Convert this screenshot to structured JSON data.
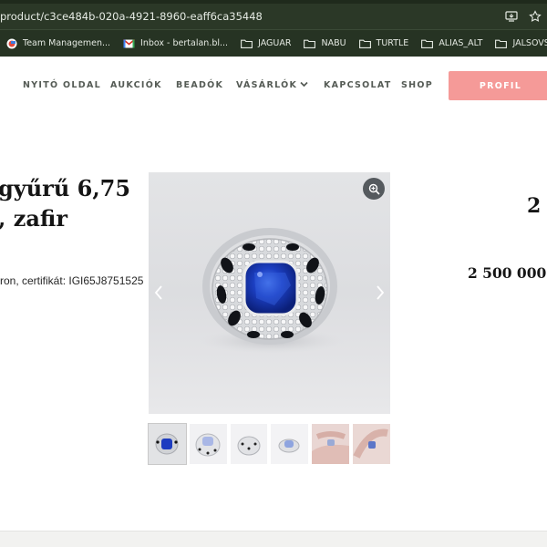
{
  "browser": {
    "url": "product/c3ce484b-020a-4921-8960-eaff6ca35448",
    "bookmarks": [
      {
        "label": "Team Managemen...",
        "icon": "app-icon"
      },
      {
        "label": "Inbox - bertalan.bl...",
        "icon": "gmail-icon"
      },
      {
        "label": "JAGUAR",
        "icon": "folder-icon"
      },
      {
        "label": "NABU",
        "icon": "folder-icon"
      },
      {
        "label": "TURTLE",
        "icon": "folder-icon"
      },
      {
        "label": "ALIAS_ALT",
        "icon": "folder-icon"
      },
      {
        "label": "JALSOVSZKY",
        "icon": "folder-icon"
      }
    ]
  },
  "nav": {
    "items": [
      "NYITÓ OLDAL",
      "AUKCIÓK",
      "BEADÓK",
      "VÁSÁRLÓK",
      "KAPCSOLAT",
      "SHOP"
    ],
    "profile_label": "PROFIL"
  },
  "product": {
    "title_line1": "gyűrű 6,75",
    "title_line2": ", zafir",
    "description": "ron, certifikát: IGI65J8751525",
    "right_number": "2",
    "price": "2 500 000"
  },
  "colors": {
    "accent": "#f59a98",
    "chrome": "#2b3827"
  }
}
